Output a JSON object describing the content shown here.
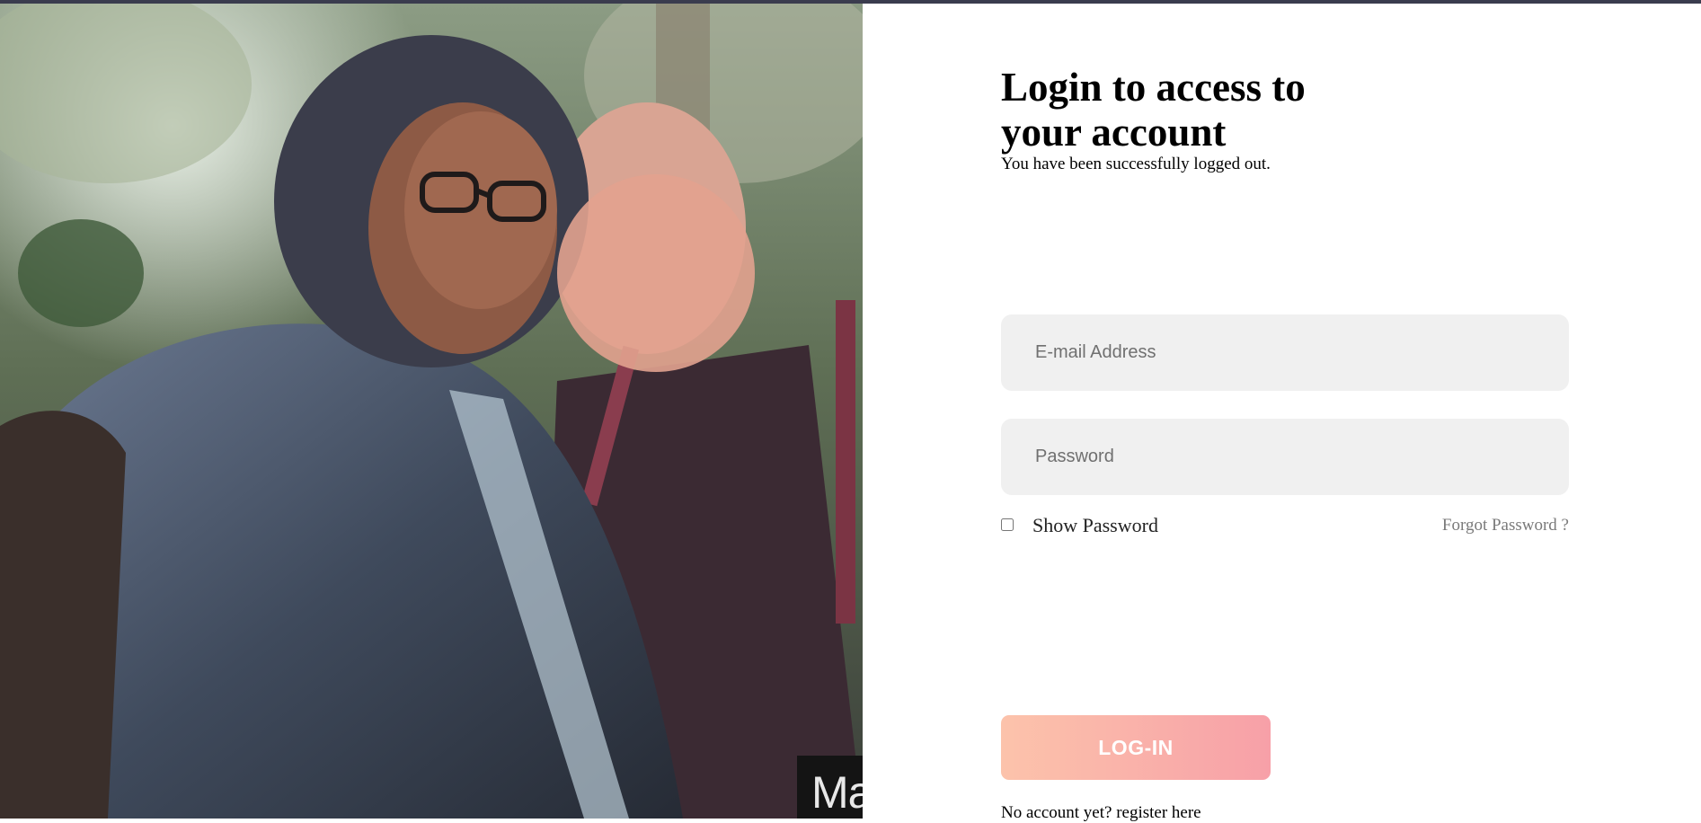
{
  "photo": {
    "caption_text": "Ma"
  },
  "login": {
    "heading": "Login to access to your account",
    "status_message": "You have been successfully logged out.",
    "email_placeholder": "E-mail Address",
    "password_placeholder": "Password",
    "show_password_label": "Show Password",
    "show_password_checked": false,
    "forgot_password_label": "Forgot Password ?",
    "login_button_label": "LOG-IN",
    "register_prefix": "No account yet?",
    "register_link_label": "register here"
  },
  "colors": {
    "top_bar": "#3a3c4e",
    "input_background": "#f0f0f0",
    "button_gradient_start": "#fcc3ab",
    "button_gradient_end": "#f7a0a8"
  }
}
